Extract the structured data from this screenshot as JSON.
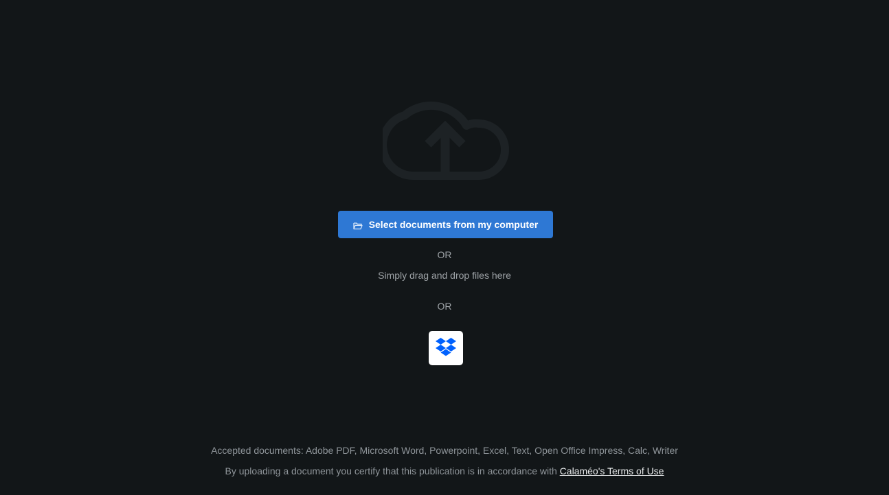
{
  "upload": {
    "cloud_icon": "cloud-upload-icon",
    "select_button": {
      "label": "Select documents from my computer",
      "icon": "folder-open-icon"
    },
    "or_1": "OR",
    "drag_drop": "Simply drag and drop files here",
    "or_2": "OR",
    "dropbox_button": {
      "icon": "dropbox-icon"
    }
  },
  "footer": {
    "accepted": "Accepted documents: Adobe PDF, Microsoft Word, Powerpoint, Excel, Text, Open Office Impress, Calc, Writer",
    "certify_text": "By uploading a document you certify that this publication is in accordance with ",
    "terms_link": "Calaméo's Terms of Use"
  },
  "colors": {
    "background": "#121618",
    "accent": "#2e78d4",
    "dropbox": "#0061fe",
    "text": "#9ea3a7",
    "link": "#e8eaeb"
  }
}
